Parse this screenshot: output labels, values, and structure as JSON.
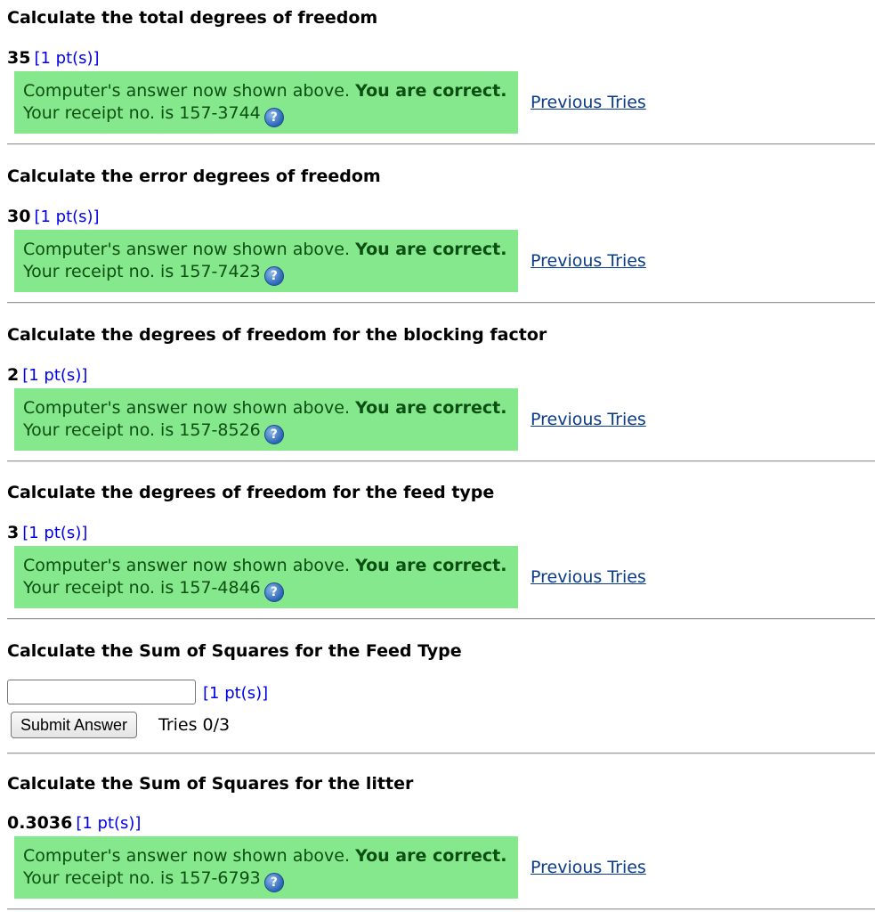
{
  "feedback": {
    "message": "Computer's answer now shown above.",
    "correct": "You are correct.",
    "receipt_prefix": "Your receipt no. is"
  },
  "points_label": "[1 pt(s)]",
  "previous_tries_label": "Previous Tries",
  "questions": [
    {
      "title": "Calculate the total degrees of freedom",
      "answer": "35",
      "receipt": "157-3744"
    },
    {
      "title": "Calculate the error degrees of freedom",
      "answer": "30",
      "receipt": "157-7423"
    },
    {
      "title": "Calculate the degrees of freedom for the blocking factor",
      "answer": "2",
      "receipt": "157-8526"
    },
    {
      "title": "Calculate the degrees of freedom for the feed type",
      "answer": "3",
      "receipt": "157-4846"
    },
    {
      "title": "Calculate the Sum of Squares for the Feed Type",
      "input_value": "",
      "submit_label": "Submit Answer",
      "tries": "Tries 0/3"
    },
    {
      "title": "Calculate the Sum of Squares for the litter",
      "answer": "0.3036",
      "receipt": "157-6793"
    }
  ],
  "help_icon": "question-help-icon"
}
